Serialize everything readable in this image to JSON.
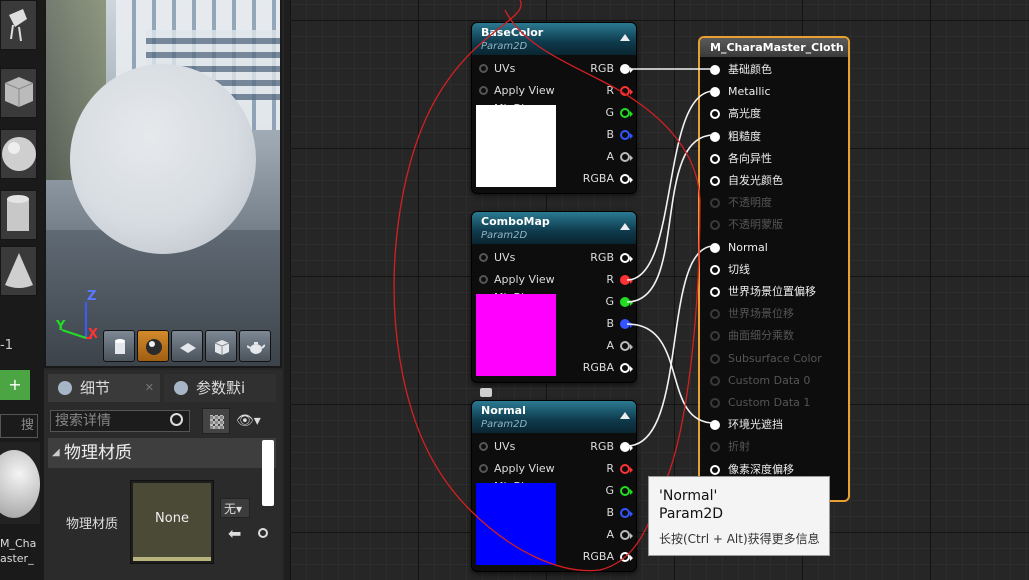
{
  "left_strip": {
    "counter": "-1",
    "add_button": "+",
    "search_cut": "搜",
    "asset_name": "M_Cha\naster_"
  },
  "viewport": {
    "axis_z": "Z",
    "axis_y": "Y",
    "axis_x": "X",
    "preview_buttons": [
      "cylinder-icon",
      "sphere-icon",
      "plane-icon",
      "cube-icon",
      "teapot-icon"
    ]
  },
  "details": {
    "tab1_label": "细节",
    "tab2_label": "参数默i",
    "search_placeholder": "搜索详情",
    "section_title": "物理材质",
    "prop_label": "物理材质",
    "prop_thumb_text": "None",
    "combo_value": "无"
  },
  "nodes": [
    {
      "title": "BaseColor",
      "subtitle": "Param2D",
      "inputs": [
        "UVs",
        "Apply View MipBias"
      ],
      "outputs": [
        "RGB",
        "R",
        "G",
        "B",
        "A",
        "RGBA"
      ],
      "preview_color": "#ffffff"
    },
    {
      "title": "ComboMap",
      "subtitle": "Param2D",
      "inputs": [
        "UVs",
        "Apply View MipBias"
      ],
      "outputs": [
        "RGB",
        "R",
        "G",
        "B",
        "A",
        "RGBA"
      ],
      "preview_color": "#ff00ff"
    },
    {
      "title": "Normal",
      "subtitle": "Param2D",
      "inputs": [
        "UVs",
        "Apply View MipBias"
      ],
      "outputs": [
        "RGB",
        "R",
        "G",
        "B",
        "A",
        "RGBA"
      ],
      "preview_color": "#0000ff"
    }
  ],
  "output_pin_colors": [
    "#ffffff",
    "#ff3333",
    "#22dd22",
    "#3355ff",
    "#bbbbbb",
    "#ffffff"
  ],
  "master": {
    "title": "M_CharaMaster_Cloth",
    "pins": [
      {
        "label": "基础颜色",
        "enabled": true,
        "connected": true
      },
      {
        "label": "Metallic",
        "enabled": true,
        "connected": true
      },
      {
        "label": "高光度",
        "enabled": true,
        "connected": false
      },
      {
        "label": "粗糙度",
        "enabled": true,
        "connected": true
      },
      {
        "label": "各向异性",
        "enabled": true,
        "connected": false
      },
      {
        "label": "自发光颜色",
        "enabled": true,
        "connected": false
      },
      {
        "label": "不透明度",
        "enabled": false,
        "connected": false
      },
      {
        "label": "不透明蒙版",
        "enabled": false,
        "connected": false
      },
      {
        "label": "Normal",
        "enabled": true,
        "connected": true
      },
      {
        "label": "切线",
        "enabled": true,
        "connected": false
      },
      {
        "label": "世界场景位置偏移",
        "enabled": true,
        "connected": false
      },
      {
        "label": "世界场景位移",
        "enabled": false,
        "connected": false
      },
      {
        "label": "曲面细分乘数",
        "enabled": false,
        "connected": false
      },
      {
        "label": "Subsurface Color",
        "enabled": false,
        "connected": false
      },
      {
        "label": "Custom Data 0",
        "enabled": false,
        "connected": false
      },
      {
        "label": "Custom Data 1",
        "enabled": false,
        "connected": false
      },
      {
        "label": "环境光遮挡",
        "enabled": true,
        "connected": true
      },
      {
        "label": "折射",
        "enabled": false,
        "connected": false
      },
      {
        "label": "像素深度偏移",
        "enabled": true,
        "connected": false
      }
    ]
  },
  "tooltip": {
    "line1": "'Normal'",
    "line2": "Param2D",
    "line3": "长按(Ctrl + Alt)获得更多信息"
  },
  "colors": {
    "accent_orange": "#e8a030",
    "node_header": "#1b5a70",
    "annotation_red": "#d42020"
  }
}
